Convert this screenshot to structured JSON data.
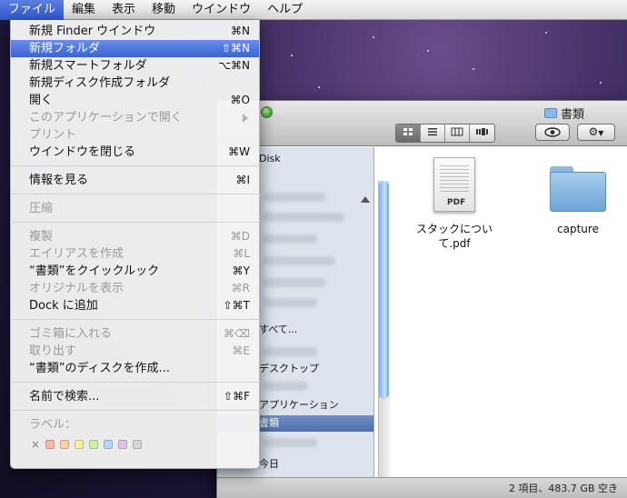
{
  "menubar": {
    "items": [
      "ファイル",
      "編集",
      "表示",
      "移動",
      "ウインドウ",
      "ヘルプ"
    ]
  },
  "file_menu": {
    "items": [
      {
        "label": "新規 Finder ウインドウ",
        "shortcut": "⌘N",
        "disabled": false
      },
      {
        "label": "新規フォルダ",
        "shortcut": "⇧⌘N",
        "disabled": false,
        "highlighted": true
      },
      {
        "label": "新規スマートフォルダ",
        "shortcut": "⌥⌘N",
        "disabled": false
      },
      {
        "label": "新規ディスク作成フォルダ",
        "shortcut": "",
        "disabled": false
      },
      {
        "label": "開く",
        "shortcut": "⌘O",
        "disabled": false
      },
      {
        "label": "このアプリケーションで開く",
        "shortcut": "",
        "disabled": true,
        "submenu": true
      },
      {
        "label": "プリント",
        "shortcut": "",
        "disabled": true
      },
      {
        "label": "ウインドウを閉じる",
        "shortcut": "⌘W",
        "disabled": false
      },
      {
        "label": "情報を見る",
        "shortcut": "⌘I",
        "disabled": false
      },
      {
        "label": "圧縮",
        "shortcut": "",
        "disabled": true
      },
      {
        "label": "複製",
        "shortcut": "⌘D",
        "disabled": true
      },
      {
        "label": "エイリアスを作成",
        "shortcut": "⌘L",
        "disabled": true
      },
      {
        "label": "“書類”をクイックルック",
        "shortcut": "⌘Y",
        "disabled": false
      },
      {
        "label": "オリジナルを表示",
        "shortcut": "⌘R",
        "disabled": true
      },
      {
        "label": "Dock に追加",
        "shortcut": "⇧⌘T",
        "disabled": false
      },
      {
        "label": "ゴミ箱に入れる",
        "shortcut": "⌘⌫",
        "disabled": true
      },
      {
        "label": "取り出す",
        "shortcut": "⌘E",
        "disabled": true
      },
      {
        "label": "“書類”のディスクを作成...",
        "shortcut": "",
        "disabled": false
      },
      {
        "label": "名前で検索...",
        "shortcut": "⇧⌘F",
        "disabled": false
      }
    ],
    "label_section": "ラベル：",
    "label_none": "×",
    "label_colors": [
      "#f6b7ad",
      "#f9d3a6",
      "#f7f0a4",
      "#cdeea7",
      "#b7d4f5",
      "#e0c1f0",
      "#d6d6d6"
    ]
  },
  "finder": {
    "title": "書類",
    "sidebar": {
      "disk_label": "Disk",
      "all_label": "すべて...",
      "desktop_label": "デスクトップ",
      "apps_label": "アプリケーション",
      "docs_label": "書類",
      "today_label": "今日"
    },
    "files": [
      {
        "name": "スタックについて.pdf",
        "kind": "pdf",
        "tag": "PDF"
      },
      {
        "name": "capture",
        "kind": "folder"
      }
    ],
    "status": "2 項目、483.7 GB 空き"
  }
}
